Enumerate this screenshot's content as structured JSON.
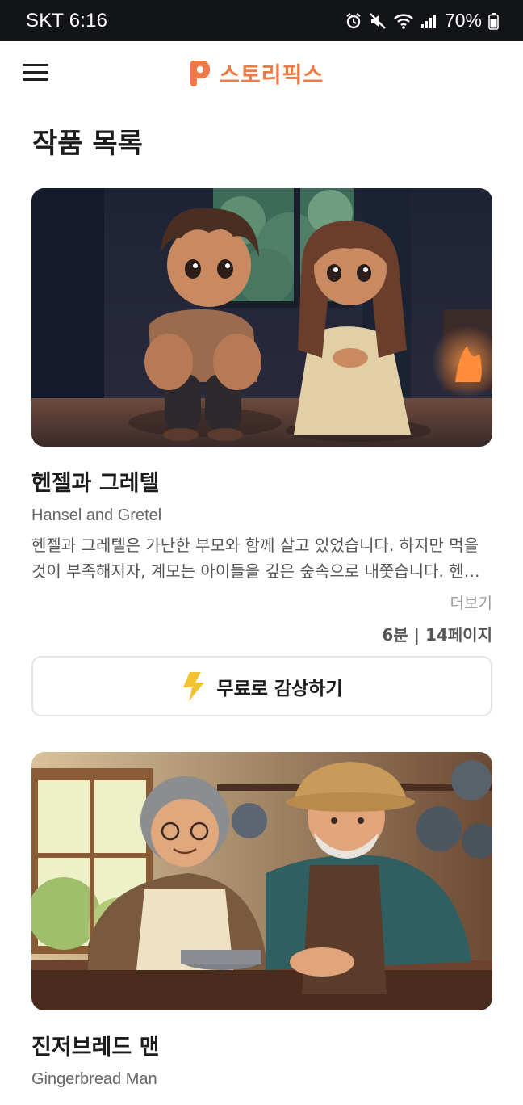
{
  "status_bar": {
    "carrier_time": "SKT 6:16",
    "battery": "70%",
    "icons": [
      "alarm-icon",
      "mute-icon",
      "wifi-icon",
      "signal-icon",
      "battery-icon"
    ]
  },
  "header": {
    "brand_name": "스토리픽스",
    "brand_color": "#ef7a45",
    "menu_icon": "hamburger-menu-icon"
  },
  "page": {
    "title": "작품 목록"
  },
  "stories": [
    {
      "title": "헨젤과 그레텔",
      "subtitle": "Hansel and Gretel",
      "description": "헨젤과 그레텔은 가난한 부모와 함께 살고 있었습니다. 하지만 먹을 것이 부족해지자, 계모는 아이들을 깊은 숲속으로 내쫓습니다. 헨젤과 그레텔은 길을 잃지 않기 위해 빵 부스러기를 떨어뜨렸습니다.",
      "more_label": "더보기",
      "meta": "6분 | 14페이지",
      "button_label": "무료로 감상하기",
      "button_icon": "lightning-icon"
    },
    {
      "title": "진저브레드 맨",
      "subtitle": "Gingerbread Man"
    }
  ]
}
